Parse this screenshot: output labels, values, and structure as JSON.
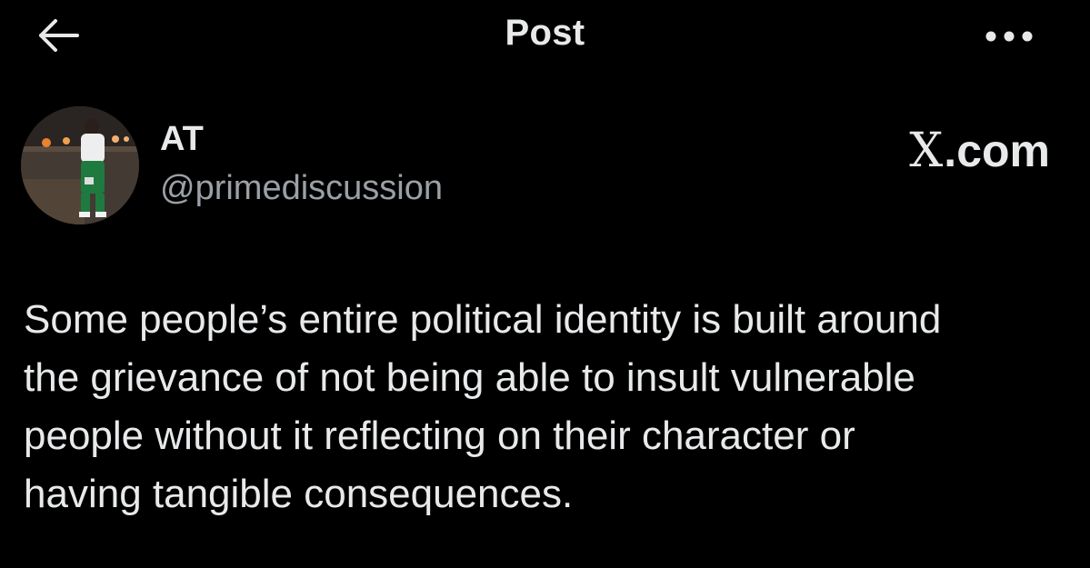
{
  "header": {
    "back_icon": "arrow-left-icon",
    "title": "Post",
    "more_icon": "more-horizontal-icon"
  },
  "author": {
    "display_name": "AT",
    "handle": "@primediscussion",
    "avatar": "avatar-photo"
  },
  "watermark": {
    "logo_letter": "X",
    "suffix": ".com"
  },
  "post": {
    "text": "Some people’s entire political identity is built around\nthe grievance of not being able to insult vulnerable\npeople without it reflecting on their character or\nhaving tangible consequences."
  },
  "colors": {
    "background": "#000000",
    "primary_text": "#e7e9ea",
    "secondary_text": "#9aa0a6"
  }
}
